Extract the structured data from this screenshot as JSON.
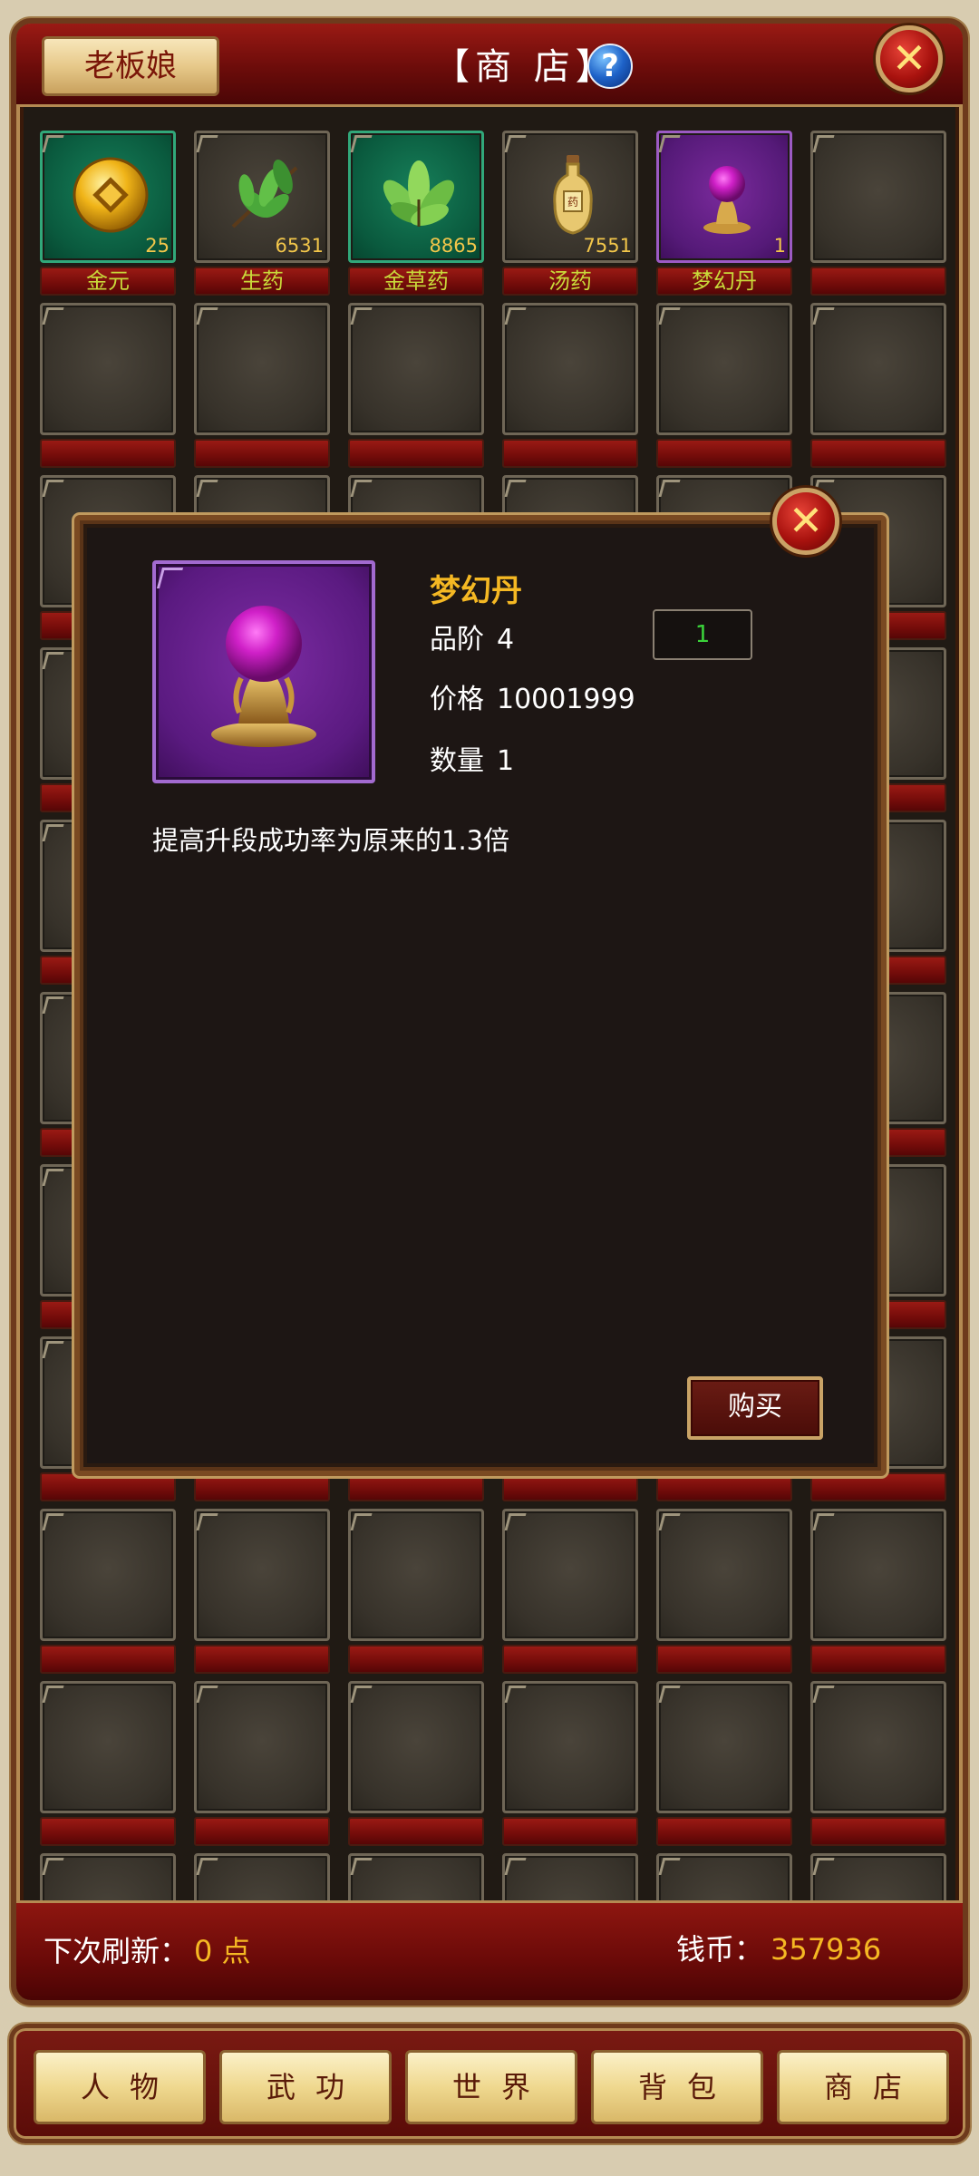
{
  "header": {
    "boss_tab": "老板娘",
    "title": "【商 店】",
    "help_icon": "?",
    "close_icon": "✕"
  },
  "items": [
    {
      "name": "金元",
      "count": "25",
      "rarity": "green",
      "icon": "gold-coin-icon"
    },
    {
      "name": "生药",
      "count": "6531",
      "rarity": "normal",
      "icon": "herb-branch-icon"
    },
    {
      "name": "金草药",
      "count": "8865",
      "rarity": "green",
      "icon": "golden-herb-icon"
    },
    {
      "name": "汤药",
      "count": "7551",
      "rarity": "normal",
      "icon": "potion-bottle-icon"
    },
    {
      "name": "梦幻丹",
      "count": "1",
      "rarity": "purple",
      "icon": "purple-orb-icon"
    }
  ],
  "popup": {
    "item_name": "梦幻丹",
    "grade_label": "品阶",
    "grade_value": "4",
    "price_label": "价格",
    "price_value": "10001999",
    "quantity_label": "数量",
    "quantity_value": "1",
    "quantity_input": "1",
    "description": "提高升段成功率为原来的1.3倍",
    "buy_label": "购买",
    "close_icon": "✕"
  },
  "footer": {
    "refresh_label": "下次刷新：",
    "refresh_value": "0 点",
    "coins_label": "钱币：",
    "coins_value": "357936"
  },
  "nav": [
    "人物",
    "武功",
    "世界",
    "背包",
    "商店"
  ],
  "colors": {
    "accent_gold": "#f5b823",
    "frame_red": "#8e1610",
    "quantity_green": "#3ad23a"
  }
}
